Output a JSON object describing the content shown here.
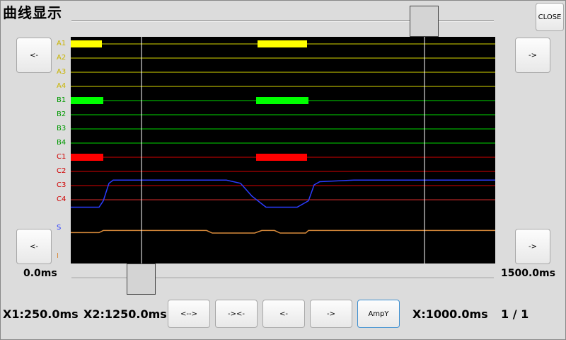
{
  "window": {
    "title": "曲线显示",
    "close_label": "CLOSE"
  },
  "nav": {
    "left_top": "<-",
    "right_top": "->",
    "left_bottom": "<-",
    "right_bottom": "->"
  },
  "range": {
    "min_label": "0.0ms",
    "max_label": "1500.0ms"
  },
  "toolbar": {
    "expand": "<-->",
    "shrink": "-><-",
    "left": "<-",
    "right": "->",
    "ampy": "AmpY"
  },
  "status": {
    "x1": "X1:250.0ms",
    "x2": "X2:1250.0ms",
    "x": "X:1000.0ms",
    "page": "1 / 1"
  },
  "colors": {
    "A": "#ffff00",
    "B": "#00ff00",
    "C": "#ff0000",
    "C4": "#ff3333",
    "S": "#3a5cff",
    "I": "#d88a3a"
  },
  "chart_data": {
    "type": "line",
    "x_unit": "ms",
    "xlim": [
      0,
      1500
    ],
    "cursor_x1": 250,
    "cursor_x2": 1250,
    "digital_channels": [
      {
        "name": "A1",
        "color": "#ffff00",
        "high": [
          [
            0,
            110
          ],
          [
            660,
            835
          ]
        ]
      },
      {
        "name": "A2",
        "color": "#ffff00",
        "high": []
      },
      {
        "name": "A3",
        "color": "#ffff00",
        "high": []
      },
      {
        "name": "A4",
        "color": "#ffff00",
        "high": []
      },
      {
        "name": "B1",
        "color": "#00ff00",
        "high": [
          [
            0,
            115
          ],
          [
            655,
            840
          ]
        ]
      },
      {
        "name": "B2",
        "color": "#00ff00",
        "high": []
      },
      {
        "name": "B3",
        "color": "#00ff00",
        "high": []
      },
      {
        "name": "B4",
        "color": "#00ff00",
        "high": []
      },
      {
        "name": "C1",
        "color": "#ff0000",
        "high": [
          [
            0,
            115
          ],
          [
            655,
            835
          ]
        ]
      },
      {
        "name": "C2",
        "color": "#ff0000",
        "high": []
      },
      {
        "name": "C3",
        "color": "#ff0000",
        "high": []
      }
    ],
    "analog_label_c4": "C4",
    "series": [
      {
        "name": "S",
        "color": "#2b3cff",
        "points": [
          [
            0,
            0.1
          ],
          [
            100,
            0.1
          ],
          [
            115,
            0.3
          ],
          [
            135,
            0.85
          ],
          [
            150,
            0.95
          ],
          [
            250,
            0.95
          ],
          [
            400,
            0.95
          ],
          [
            550,
            0.95
          ],
          [
            600,
            0.85
          ],
          [
            640,
            0.45
          ],
          [
            690,
            0.1
          ],
          [
            800,
            0.1
          ],
          [
            840,
            0.3
          ],
          [
            860,
            0.8
          ],
          [
            880,
            0.9
          ],
          [
            1000,
            0.95
          ],
          [
            1500,
            0.95
          ]
        ]
      },
      {
        "name": "I",
        "color": "#d88a3a",
        "points": [
          [
            0,
            0.3
          ],
          [
            100,
            0.3
          ],
          [
            115,
            0.55
          ],
          [
            240,
            0.55
          ],
          [
            480,
            0.55
          ],
          [
            500,
            0.25
          ],
          [
            650,
            0.25
          ],
          [
            675,
            0.55
          ],
          [
            720,
            0.55
          ],
          [
            740,
            0.25
          ],
          [
            830,
            0.25
          ],
          [
            840,
            0.55
          ],
          [
            1500,
            0.55
          ]
        ]
      }
    ]
  }
}
